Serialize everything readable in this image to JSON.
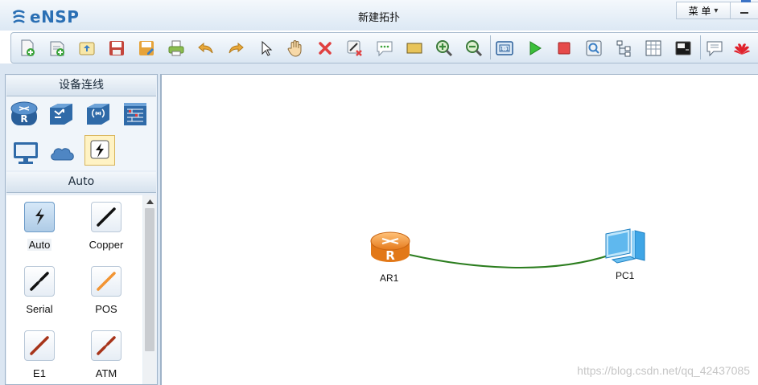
{
  "app": {
    "logo_text": "eNSP",
    "window_title": "新建拓扑",
    "menu_label": "菜 单",
    "menu_arrow": "▾"
  },
  "toolbar": {
    "icons": [
      "new-topology-icon",
      "new-template-icon",
      "open-icon",
      "save-icon",
      "save-as-icon",
      "print-icon",
      "undo-icon",
      "redo-icon",
      "select-pointer-icon",
      "hand-pan-icon",
      "delete-icon",
      "delete-link-icon",
      "text-annotation-icon",
      "shape-icon",
      "zoom-in-icon",
      "zoom-out-icon",
      "fit-view-icon",
      "start-device-icon",
      "stop-device-icon",
      "capture-icon",
      "topology-tree-icon",
      "grid-icon",
      "console-icon",
      "message-icon",
      "huawei-logo-icon"
    ]
  },
  "left_panel": {
    "device_header": "设备连线",
    "devices": [
      "router-icon",
      "switch-icon",
      "wireless-icon",
      "firewall-icon",
      "pc-terminal-icon",
      "cloud-icon",
      "connection-icon"
    ],
    "cable_header": "Auto",
    "cables": [
      {
        "label": "Auto",
        "color": "#1a1a1a",
        "kind": "auto",
        "selected": true
      },
      {
        "label": "Copper",
        "color": "#111111",
        "kind": "line",
        "selected": false
      },
      {
        "label": "Serial",
        "color": "#111111",
        "kind": "dashed",
        "selected": false
      },
      {
        "label": "POS",
        "color": "#f29433",
        "kind": "line",
        "selected": false
      },
      {
        "label": "E1",
        "color": "#a7341a",
        "kind": "line",
        "selected": false
      },
      {
        "label": "ATM",
        "color": "#a7341a",
        "kind": "dashed",
        "selected": false
      }
    ]
  },
  "canvas": {
    "nodes": [
      {
        "label": "AR1",
        "type": "router-icon"
      },
      {
        "label": "PC1",
        "type": "pc-icon"
      }
    ],
    "link_color": "#2b7d1e",
    "watermark": "https://blog.csdn.net/qq_42437085"
  }
}
